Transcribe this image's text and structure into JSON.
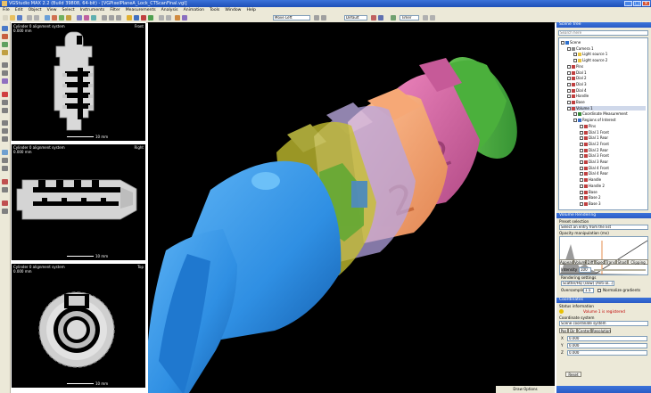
{
  "window": {
    "title": "VGStudio MAX 2.2 (Build 39808, 64-bit) - [VGPixelPlaneA_Lock_CTScanFinal.vgl]"
  },
  "menu": [
    "File",
    "Edit",
    "Object",
    "View",
    "Select",
    "Instruments",
    "Filter",
    "Measurements",
    "Analysis",
    "Animation",
    "Tools",
    "Window",
    "Help"
  ],
  "toolbar": {
    "select1": "Move Left",
    "select2": "Default",
    "select3": "Timer"
  },
  "views2d": [
    {
      "title": "Cylinder 0 alignment system",
      "subtitle": "0.000 mm",
      "orient": "Front",
      "scale": "10 mm"
    },
    {
      "title": "Cylinder 0 alignment system",
      "subtitle": "0.000 mm",
      "orient": "Right",
      "scale": "10 mm"
    },
    {
      "title": "Cylinder 0 alignment system",
      "subtitle": "0.000 mm",
      "orient": "Top",
      "scale": "10 mm"
    }
  ],
  "scene_tree": {
    "title": "Scene Tree",
    "search_placeholder": "Search here",
    "items": [
      {
        "label": "Scene",
        "indent": 0,
        "color": "#2d6fcc"
      },
      {
        "label": "Camera 1",
        "indent": 1,
        "color": "#888888"
      },
      {
        "label": "Light source 1",
        "indent": 2,
        "color": "#e8c440"
      },
      {
        "label": "Light source 2",
        "indent": 2,
        "color": "#e8c440"
      },
      {
        "label": "Pins",
        "indent": 1,
        "color": "#c04040"
      },
      {
        "label": "Dial 1",
        "indent": 1,
        "color": "#c04040"
      },
      {
        "label": "Dial 2",
        "indent": 1,
        "color": "#c04040"
      },
      {
        "label": "Dial 3",
        "indent": 1,
        "color": "#c04040"
      },
      {
        "label": "Dial 4",
        "indent": 1,
        "color": "#c04040"
      },
      {
        "label": "Handle",
        "indent": 1,
        "color": "#c04040"
      },
      {
        "label": "Base",
        "indent": 1,
        "color": "#c04040"
      },
      {
        "label": "Volume 1",
        "indent": 1,
        "color": "#c04040",
        "selected": true
      },
      {
        "label": "Coordinate Measurement",
        "indent": 2,
        "color": "#3a8a3a"
      },
      {
        "label": "Regions of Interest",
        "indent": 2,
        "color": "#3a6fc8"
      },
      {
        "label": "Pins",
        "indent": 3,
        "color": "#c04040"
      },
      {
        "label": "Dial 1 Front",
        "indent": 3,
        "color": "#c04040"
      },
      {
        "label": "Dial 1 Rear",
        "indent": 3,
        "color": "#c04040"
      },
      {
        "label": "Dial 2 Front",
        "indent": 3,
        "color": "#c04040"
      },
      {
        "label": "Dial 2 Rear",
        "indent": 3,
        "color": "#c04040"
      },
      {
        "label": "Dial 3 Front",
        "indent": 3,
        "color": "#c04040"
      },
      {
        "label": "Dial 3 Rear",
        "indent": 3,
        "color": "#c04040"
      },
      {
        "label": "Dial 4 Front",
        "indent": 3,
        "color": "#c04040"
      },
      {
        "label": "Dial 4 Rear",
        "indent": 3,
        "color": "#c04040"
      },
      {
        "label": "Handle",
        "indent": 3,
        "color": "#c04040"
      },
      {
        "label": "Handle 2",
        "indent": 3,
        "color": "#c04040"
      },
      {
        "label": "Base",
        "indent": 3,
        "color": "#c04040"
      },
      {
        "label": "Base 2",
        "indent": 3,
        "color": "#c04040"
      },
      {
        "label": "Base 3",
        "indent": 3,
        "color": "#c04040"
      }
    ]
  },
  "volume_rendering": {
    "title": "Volume Rendering",
    "preset_label": "Preset selection",
    "preset_value": "Select an entry from the list",
    "opacity_label": "Opacity manipulation (ms)",
    "tabs": [
      "Appearance",
      "Volume",
      "Diff",
      "Spec",
      "Trans",
      "Shad",
      "Clipping"
    ],
    "intensity_label": "Intensity",
    "intensity_value": "100",
    "rendering_label": "Rendering settings",
    "rendering_value": "Scatter/HQ (slow) (Anti-al...)",
    "oversampling_label": "Oversampling",
    "oversampling_value": "1.5",
    "normalize_label": "Normalize gradients"
  },
  "coordinate_panel": {
    "title": "Coordinates",
    "status_label": "Status information",
    "status_value": "Volume 1 is registered",
    "cs_label": "Coordinate system",
    "cs_value": "Scene coordinate system",
    "tabs": [
      "Pos",
      "Dir",
      "Center",
      "Resolution"
    ],
    "axes": [
      "X",
      "Y",
      "Z"
    ],
    "values": [
      "0.000",
      "0.000",
      "0.000"
    ],
    "reset_label": "Reset"
  },
  "status": {
    "text": "Draw Options"
  },
  "colors": {
    "blue": "#2f8fe3",
    "yellow": "#c6c030",
    "green": "#5ea832",
    "lavender": "#b7a6e6",
    "orange": "#f2a070",
    "magenta": "#d86aa4",
    "green2": "#3fa83f",
    "titlebar": "#2a5bc6"
  }
}
